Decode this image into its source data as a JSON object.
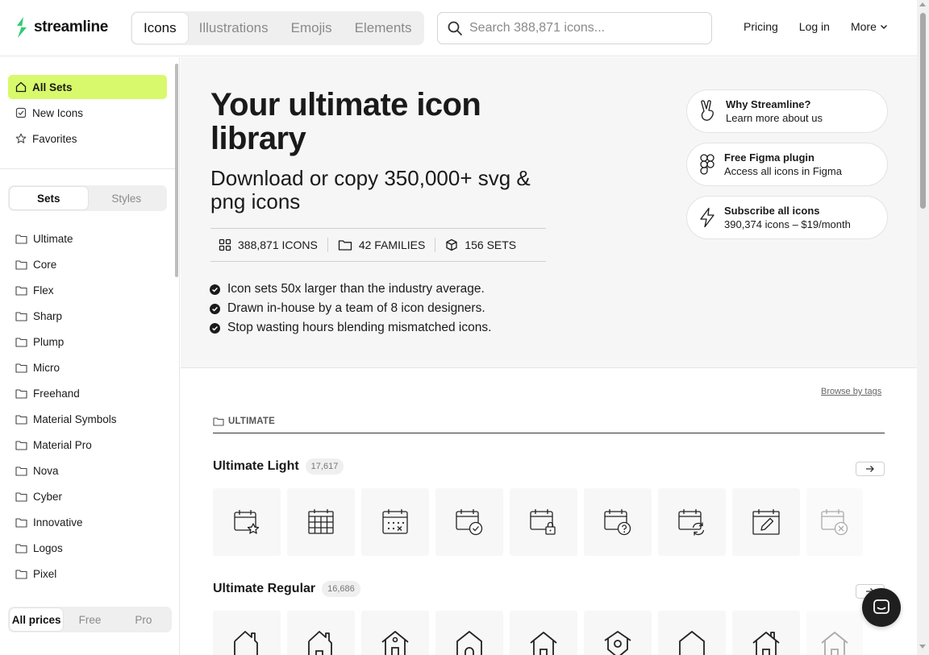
{
  "brand": {
    "name": "streamline",
    "accent": "#d8f96b"
  },
  "header": {
    "tabs": [
      "Icons",
      "Illustrations",
      "Emojis",
      "Elements"
    ],
    "active_tab": "Icons",
    "search_placeholder": "Search 388,871 icons...",
    "nav": {
      "pricing": "Pricing",
      "login": "Log in",
      "more": "More"
    }
  },
  "sidebar": {
    "top_items": [
      {
        "label": "All Sets",
        "icon": "home-icon",
        "active": true
      },
      {
        "label": "New Icons",
        "icon": "check-square-icon",
        "active": false
      },
      {
        "label": "Favorites",
        "icon": "star-icon",
        "active": false
      }
    ],
    "mode_tabs": [
      "Sets",
      "Styles"
    ],
    "active_mode": "Sets",
    "sets": [
      "Ultimate",
      "Core",
      "Flex",
      "Sharp",
      "Plump",
      "Micro",
      "Freehand",
      "Material Symbols",
      "Material Pro",
      "Nova",
      "Cyber",
      "Innovative",
      "Logos",
      "Pixel"
    ],
    "price_filter": [
      "All prices",
      "Free",
      "Pro"
    ],
    "active_price": "All prices"
  },
  "hero": {
    "title": "Your ultimate icon library",
    "subtitle": "Download or copy 350,000+ svg & png icons",
    "stats": [
      {
        "label": "388,871 ICONS",
        "icon": "grid-icon"
      },
      {
        "label": "42 FAMILIES",
        "icon": "folder-icon"
      },
      {
        "label": "156 SETS",
        "icon": "cube-icon"
      }
    ],
    "bullets": [
      "Icon sets 50x larger than the industry average.",
      "Drawn in-house by a team of 8 icon designers.",
      "Stop wasting hours blending mismatched icons."
    ],
    "promos": [
      {
        "title": "Why Streamline?",
        "desc": "Learn more about us",
        "icon": "peace-hand-icon"
      },
      {
        "title": "Free Figma plugin",
        "desc": "Access all icons in Figma",
        "icon": "figma-icon"
      },
      {
        "title": "Subscribe all icons",
        "desc": "390,374 icons – $19/month",
        "icon": "lightning-icon"
      }
    ]
  },
  "content": {
    "browse_tags": "Browse by tags",
    "section_label": "ULTIMATE",
    "sets": [
      {
        "name": "Ultimate Light",
        "count": "17,617"
      },
      {
        "name": "Ultimate Regular",
        "count": "16,686"
      }
    ]
  }
}
